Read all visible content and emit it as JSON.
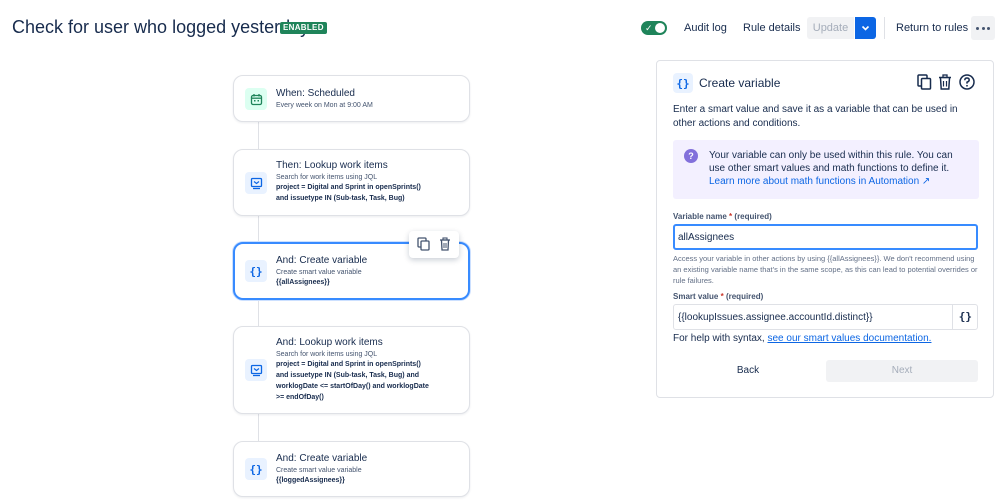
{
  "header": {
    "title": "Check for user who logged yesterday",
    "status_badge": "ENABLED",
    "audit_log": "Audit log",
    "rule_details": "Rule details",
    "update": "Update",
    "return_to_rules": "Return to rules"
  },
  "flow": {
    "steps": [
      {
        "title": "When: Scheduled",
        "subtitle": "Every week on Mon at 9:00 AM",
        "icon": "calendar-icon",
        "lines": []
      },
      {
        "title": "Then: Lookup work items",
        "subtitle": "Search for work items using JQL",
        "icon": "lookup-icon",
        "lines": [
          "project = Digital and Sprint in openSprints()",
          "and issuetype IN (Sub-task, Task, Bug)"
        ]
      },
      {
        "title": "And: Create variable",
        "subtitle": "Create smart value variable",
        "icon": "braces-icon",
        "lines": [
          "{{allAssignees}}"
        ],
        "selected": true
      },
      {
        "title": "And: Lookup work items",
        "subtitle": "Search for work items using JQL",
        "icon": "lookup-icon",
        "lines": [
          "project = Digital and Sprint in openSprints()",
          "and issuetype IN (Sub-task, Task, Bug) and",
          "worklogDate <= startOfDay() and worklogDate",
          ">= endOfDay()"
        ]
      },
      {
        "title": "And: Create variable",
        "subtitle": "Create smart value variable",
        "icon": "braces-icon",
        "lines": [
          "{{loggedAssignees}}"
        ]
      }
    ]
  },
  "panel": {
    "title": "Create variable",
    "description": "Enter a smart value and save it as a variable that can be used in other actions and conditions.",
    "info_text": "Your variable can only be used within this rule. You can use other smart values and math functions to define it. ",
    "info_link": "Learn more about math functions in Automation ↗",
    "variable_name_label": "Variable name",
    "required_marker": "*",
    "required_text": "(required)",
    "variable_name_value": "allAssignees",
    "variable_name_help": "Access your variable in other actions by using {{allAssignees}}. We don't recommend using an existing variable name that's in the same scope, as this can lead to potential overrides or rule failures.",
    "smart_value_label": "Smart value",
    "smart_value": "{{lookupIssues.assignee.accountId.distinct}}",
    "syntax_help_prefix": "For help with syntax, ",
    "syntax_help_link": "see our smart values documentation.",
    "back": "Back",
    "next": "Next"
  },
  "colors": {
    "accent": "#0c66e4",
    "enabled_green": "#1f845a",
    "info_bg": "#f3f0ff",
    "selected_border": "#388bff"
  }
}
